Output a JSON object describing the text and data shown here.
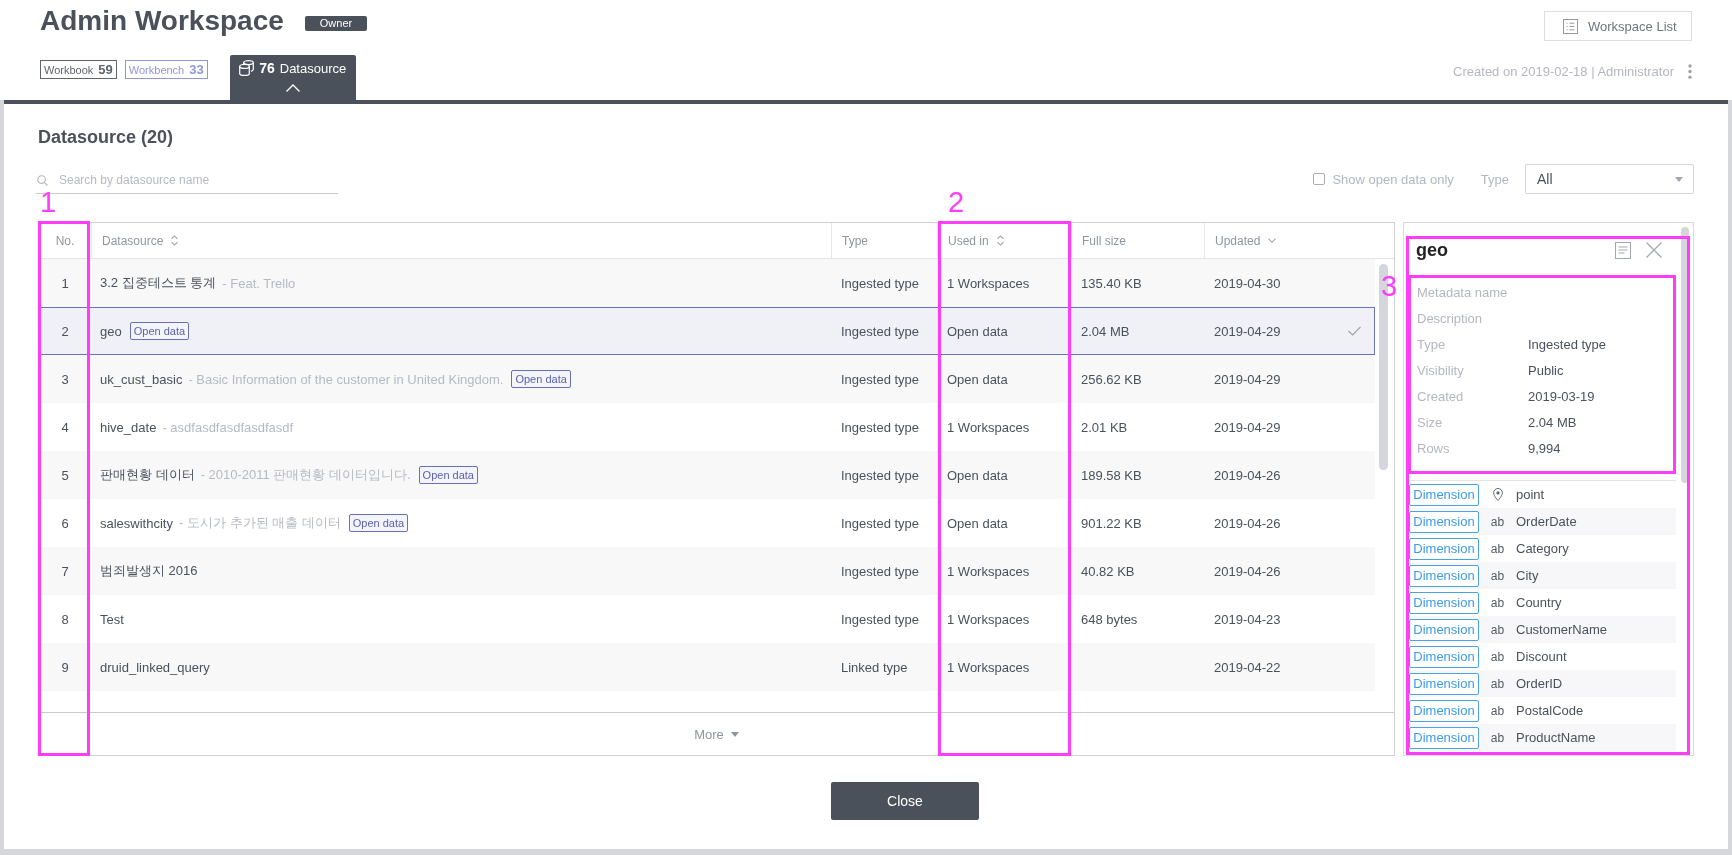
{
  "header": {
    "title": "Admin Workspace",
    "role_badge": "Owner",
    "workspace_list_button": "Workspace List",
    "created_info": "Created on 2019-02-18 | Administrator"
  },
  "tabs": [
    {
      "label": "Workbook",
      "count": "59",
      "selected": false,
      "color": "#5f646d"
    },
    {
      "label": "Workbench",
      "count": "33",
      "selected": false,
      "color": "#8f97da"
    },
    {
      "label": "Datasource",
      "count": "76",
      "selected": true
    }
  ],
  "dialog": {
    "heading": "Datasource (20)",
    "search": {
      "placeholder": "Search by datasource name"
    },
    "open_data_filter": {
      "label": "Show open data only",
      "checked": false
    },
    "type_filter": {
      "label": "Type",
      "value": "All"
    },
    "table": {
      "columns": [
        {
          "label": "No.",
          "sortable": false,
          "sorted": false
        },
        {
          "label": "Datasource",
          "sortable": true,
          "sorted": false
        },
        {
          "label": "Type",
          "sortable": false,
          "sorted": false
        },
        {
          "label": "Used in",
          "sortable": true,
          "sorted": false
        },
        {
          "label": "Full size",
          "sortable": false,
          "sorted": false
        },
        {
          "label": "Updated",
          "sortable": true,
          "sorted": true
        }
      ],
      "rows": [
        {
          "no": "1",
          "datasource": {
            "name": "3.2 집중테스트 통계",
            "description": "- Feat. Trello"
          },
          "type": "Ingested type",
          "used_in": "1 Workspaces",
          "full_size": "135.40 KB",
          "updated": "2019-04-30",
          "selected": false
        },
        {
          "no": "2",
          "datasource": {
            "name": "geo",
            "badge": "Open data"
          },
          "type": "Ingested type",
          "used_in": "Open data",
          "full_size": "2.04 MB",
          "updated": "2019-04-29",
          "selected": true
        },
        {
          "no": "3",
          "datasource": {
            "name": "uk_cust_basic",
            "description": "- Basic Information of the customer in United Kingdom.",
            "badge": "Open data"
          },
          "type": "Ingested type",
          "used_in": "Open data",
          "full_size": "256.62 KB",
          "updated": "2019-04-29",
          "selected": false
        },
        {
          "no": "4",
          "datasource": {
            "name": "hive_date",
            "description": "- asdfasdfasdfasdfasdf"
          },
          "type": "Ingested type",
          "used_in": "1 Workspaces",
          "full_size": "2.01 KB",
          "updated": "2019-04-29",
          "selected": false
        },
        {
          "no": "5",
          "datasource": {
            "name": "판매현황 데이터",
            "description": "- 2010-2011 판매현황 데이터입니다.",
            "badge": "Open data"
          },
          "type": "Ingested type",
          "used_in": "Open data",
          "full_size": "189.58 KB",
          "updated": "2019-04-26",
          "selected": false
        },
        {
          "no": "6",
          "datasource": {
            "name": "saleswithcity",
            "description": "- 도시가 추가된 매출 데이터",
            "badge": "Open data"
          },
          "type": "Ingested type",
          "used_in": "Open data",
          "full_size": "901.22 KB",
          "updated": "2019-04-26",
          "selected": false
        },
        {
          "no": "7",
          "datasource": {
            "name": "범죄발생지 2016"
          },
          "type": "Ingested type",
          "used_in": "1 Workspaces",
          "full_size": "40.82 KB",
          "updated": "2019-04-26",
          "selected": false
        },
        {
          "no": "8",
          "datasource": {
            "name": "Test"
          },
          "type": "Ingested type",
          "used_in": "1 Workspaces",
          "full_size": "648 bytes",
          "updated": "2019-04-23",
          "selected": false
        },
        {
          "no": "9",
          "datasource": {
            "name": "druid_linked_query"
          },
          "type": "Linked type",
          "used_in": "1 Workspaces",
          "updated": "2019-04-22",
          "selected": false
        }
      ],
      "more_button": "More"
    },
    "detail": {
      "title": "geo",
      "metadata": [
        {
          "label": "Metadata name"
        },
        {
          "label": "Description"
        },
        {
          "label": "Type",
          "value": "Ingested type"
        },
        {
          "label": "Visibility",
          "value": "Public"
        },
        {
          "label": "Created",
          "value": "2019-03-19"
        },
        {
          "label": "Size",
          "value": "2.04 MB"
        },
        {
          "label": "Rows",
          "value": "9,994"
        }
      ],
      "fields": [
        {
          "role": "Dimension",
          "kind": "geo",
          "name": "point"
        },
        {
          "role": "Dimension",
          "kind": "text",
          "type_label": "ab",
          "name": "OrderDate"
        },
        {
          "role": "Dimension",
          "kind": "text",
          "type_label": "ab",
          "name": "Category"
        },
        {
          "role": "Dimension",
          "kind": "text",
          "type_label": "ab",
          "name": "City"
        },
        {
          "role": "Dimension",
          "kind": "text",
          "type_label": "ab",
          "name": "Country"
        },
        {
          "role": "Dimension",
          "kind": "text",
          "type_label": "ab",
          "name": "CustomerName"
        },
        {
          "role": "Dimension",
          "kind": "text",
          "type_label": "ab",
          "name": "Discount"
        },
        {
          "role": "Dimension",
          "kind": "text",
          "type_label": "ab",
          "name": "OrderID"
        },
        {
          "role": "Dimension",
          "kind": "text",
          "type_label": "ab",
          "name": "PostalCode"
        },
        {
          "role": "Dimension",
          "kind": "text",
          "type_label": "ab",
          "name": "ProductName"
        }
      ]
    },
    "close_button": "Close"
  },
  "annotations": [
    {
      "label": "1"
    },
    {
      "label": "2"
    },
    {
      "label": "3"
    }
  ]
}
